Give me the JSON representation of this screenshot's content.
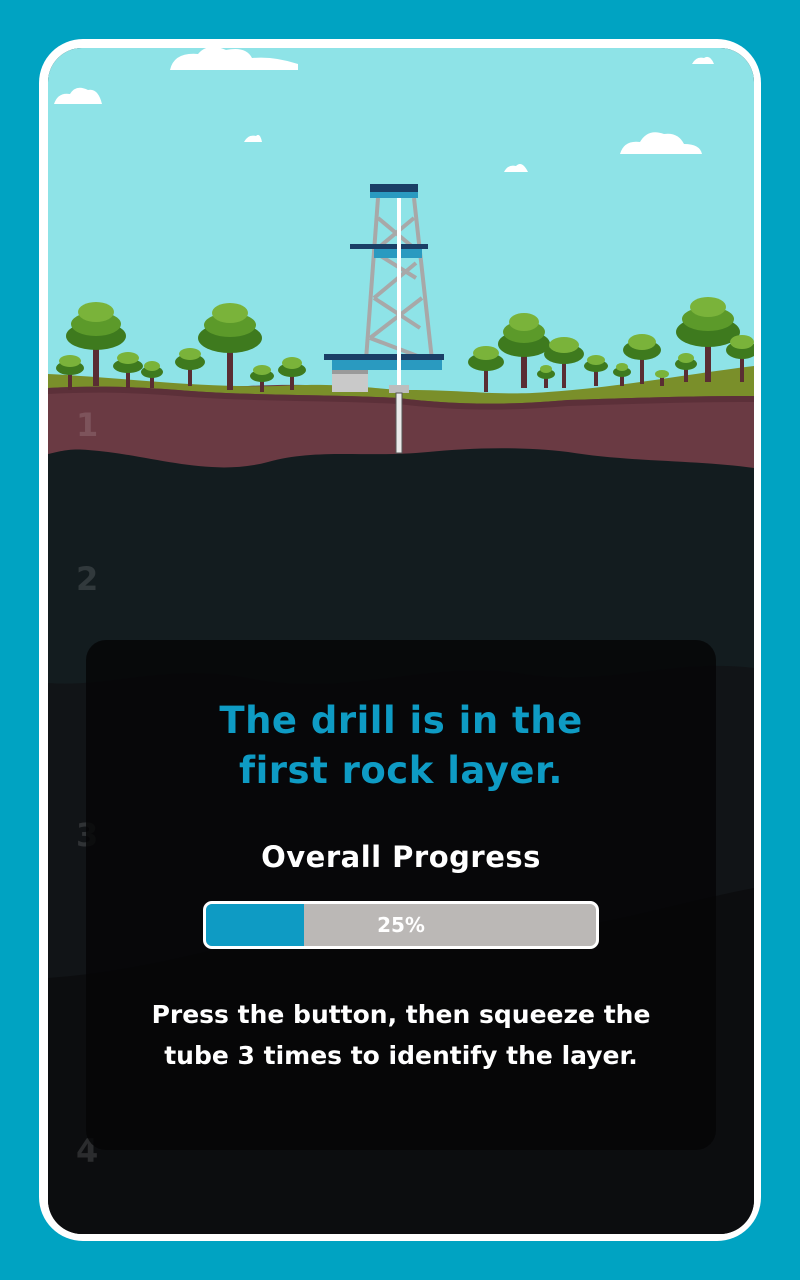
{
  "layers": [
    {
      "label": "1"
    },
    {
      "label": "2"
    },
    {
      "label": "3"
    },
    {
      "label": "4"
    }
  ],
  "status": {
    "line1": "The drill is in the",
    "line2": "first rock layer."
  },
  "progress": {
    "label": "Overall Progress",
    "value": 0.25,
    "text": "25%"
  },
  "instructions": {
    "line1": "Press the button, then squeeze the",
    "line2": "tube 3 times to identify the layer."
  },
  "colors": {
    "frame": "#00A3C2",
    "sky": "#8EE3E7",
    "soil": "#6A3A43",
    "accent": "#0E9BC4",
    "progress_track": "#BBB8B6"
  }
}
